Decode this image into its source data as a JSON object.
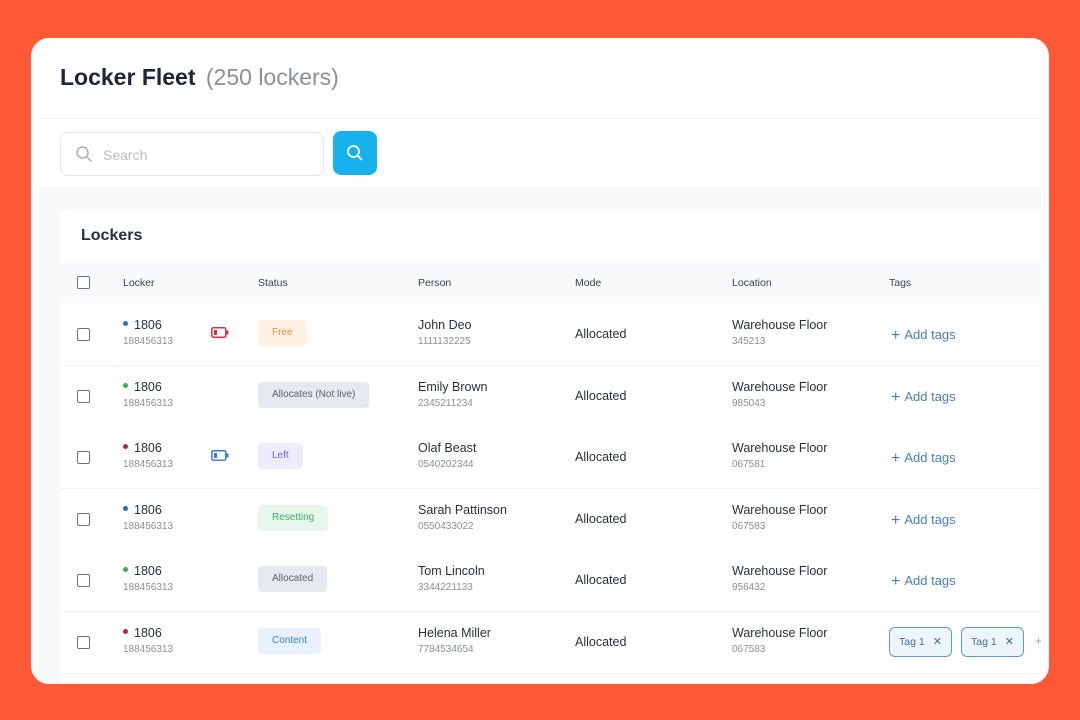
{
  "header": {
    "title": "Locker Fleet",
    "count": "(250 lockers)"
  },
  "search": {
    "placeholder": "Search"
  },
  "card": {
    "title": "Lockers"
  },
  "columns": [
    "Locker",
    "Status",
    "Person",
    "Mode",
    "Location",
    "Tags"
  ],
  "rows": [
    {
      "locker": "1806",
      "locker_sub": "188456313",
      "dot_color": "#2F6FB0",
      "battery": "low",
      "status": "Free",
      "status_bg": "#FFF1E4",
      "status_fg": "#F08A3C",
      "person": "John Deo",
      "person_sub": "1111132225",
      "mode": "Allocated",
      "location": "Warehouse Floor",
      "location_sub": "345213",
      "add_tags": "Add tags",
      "tags": []
    },
    {
      "locker": "1806",
      "locker_sub": "188456313",
      "dot_color": "#3BAA5C",
      "battery": "none",
      "status": "Allocates (Not live)",
      "status_bg": "#E6E9EE",
      "status_fg": "#5D6470",
      "person": "Emily Brown",
      "person_sub": "2345211234",
      "mode": "Allocated",
      "location": "Warehouse Floor",
      "location_sub": "985043",
      "add_tags": "Add tags",
      "tags": []
    },
    {
      "locker": "1806",
      "locker_sub": "188456313",
      "dot_color": "#C0262D",
      "battery": "normal",
      "status": "Left",
      "status_bg": "#EEECFB",
      "status_fg": "#6B5FD0",
      "person": "Olaf Beast",
      "person_sub": "0540202344",
      "mode": "Allocated",
      "location": "Warehouse Floor",
      "location_sub": "067581",
      "add_tags": "Add tags",
      "tags": []
    },
    {
      "locker": "1806",
      "locker_sub": "188456313",
      "dot_color": "#2F6FB0",
      "battery": "none",
      "status": "Resetting",
      "status_bg": "#E7F7EC",
      "status_fg": "#3EAF68",
      "person": "Sarah Pattinson",
      "person_sub": "0550433022",
      "mode": "Allocated",
      "location": "Warehouse Floor",
      "location_sub": "067583",
      "add_tags": "Add tags",
      "tags": []
    },
    {
      "locker": "1806",
      "locker_sub": "188456313",
      "dot_color": "#3BAA5C",
      "battery": "none",
      "status": "Allocated",
      "status_bg": "#E6E9EE",
      "status_fg": "#5D6470",
      "person": "Tom Lincoln",
      "person_sub": "3344221133",
      "mode": "Allocated",
      "location": "Warehouse Floor",
      "location_sub": "956432",
      "add_tags": "Add tags",
      "tags": []
    },
    {
      "locker": "1806",
      "locker_sub": "188456313",
      "dot_color": "#C0262D",
      "battery": "none",
      "status": "Content",
      "status_bg": "#E8F1FC",
      "status_fg": "#3D7DD0",
      "person": "Helena Miller",
      "person_sub": "7784534654",
      "mode": "Allocated",
      "location": "Warehouse Floor",
      "location_sub": "067583",
      "add_tags": "",
      "tags": [
        "Tag 1",
        "Tag 1"
      ]
    }
  ],
  "icons": {
    "search": "search-icon",
    "battery_low": "battery-low-icon",
    "battery": "battery-icon",
    "plus": "plus-icon",
    "close": "close-icon"
  },
  "colors": {
    "background": "#FF5A35",
    "accent": "#17B1EE",
    "link": "#4A7FB5"
  }
}
